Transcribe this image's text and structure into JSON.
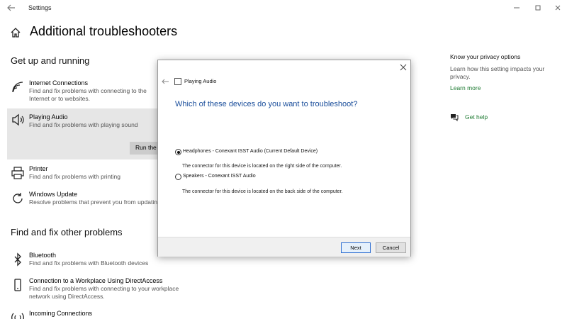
{
  "window": {
    "title": "Settings"
  },
  "page": {
    "title": "Additional troubleshooters"
  },
  "sections": {
    "get_up": "Get up and running",
    "find_fix": "Find and fix other problems"
  },
  "items": {
    "internet": {
      "name": "Internet Connections",
      "desc": "Find and fix problems with connecting to the Internet or to websites."
    },
    "audio": {
      "name": "Playing Audio",
      "desc": "Find and fix problems with playing sound",
      "run_label": "Run the troubleshooter"
    },
    "printer": {
      "name": "Printer",
      "desc": "Find and fix problems with printing"
    },
    "update": {
      "name": "Windows Update",
      "desc": "Resolve problems that prevent you from updating Windows."
    },
    "bluetooth": {
      "name": "Bluetooth",
      "desc": "Find and fix problems with Bluetooth devices"
    },
    "directaccess": {
      "name": "Connection to a Workplace Using DirectAccess",
      "desc": "Find and fix problems with connecting to your workplace network using DirectAccess."
    },
    "incoming": {
      "name": "Incoming Connections"
    }
  },
  "right_column": {
    "privacy_title": "Know your privacy options",
    "privacy_text": "Learn how this setting impacts your privacy.",
    "learn_more": "Learn more",
    "get_help": "Get help"
  },
  "dialog": {
    "app_title": "Playing Audio",
    "question": "Which of these devices do you want to troubleshoot?",
    "options": [
      {
        "label": "Headphones - Conexant ISST Audio (Current Default Device)",
        "desc": "The connector for this device is located on the right side of the computer.",
        "selected": true
      },
      {
        "label": "Speakers - Conexant ISST Audio",
        "desc": "The connector for this device is located on the back side of the computer.",
        "selected": false
      }
    ],
    "next_label": "Next",
    "cancel_label": "Cancel"
  },
  "colors": {
    "link_green": "#1e7a32",
    "dialog_question_blue": "#1a4e9b",
    "selected_bg": "#e6e6e6"
  }
}
